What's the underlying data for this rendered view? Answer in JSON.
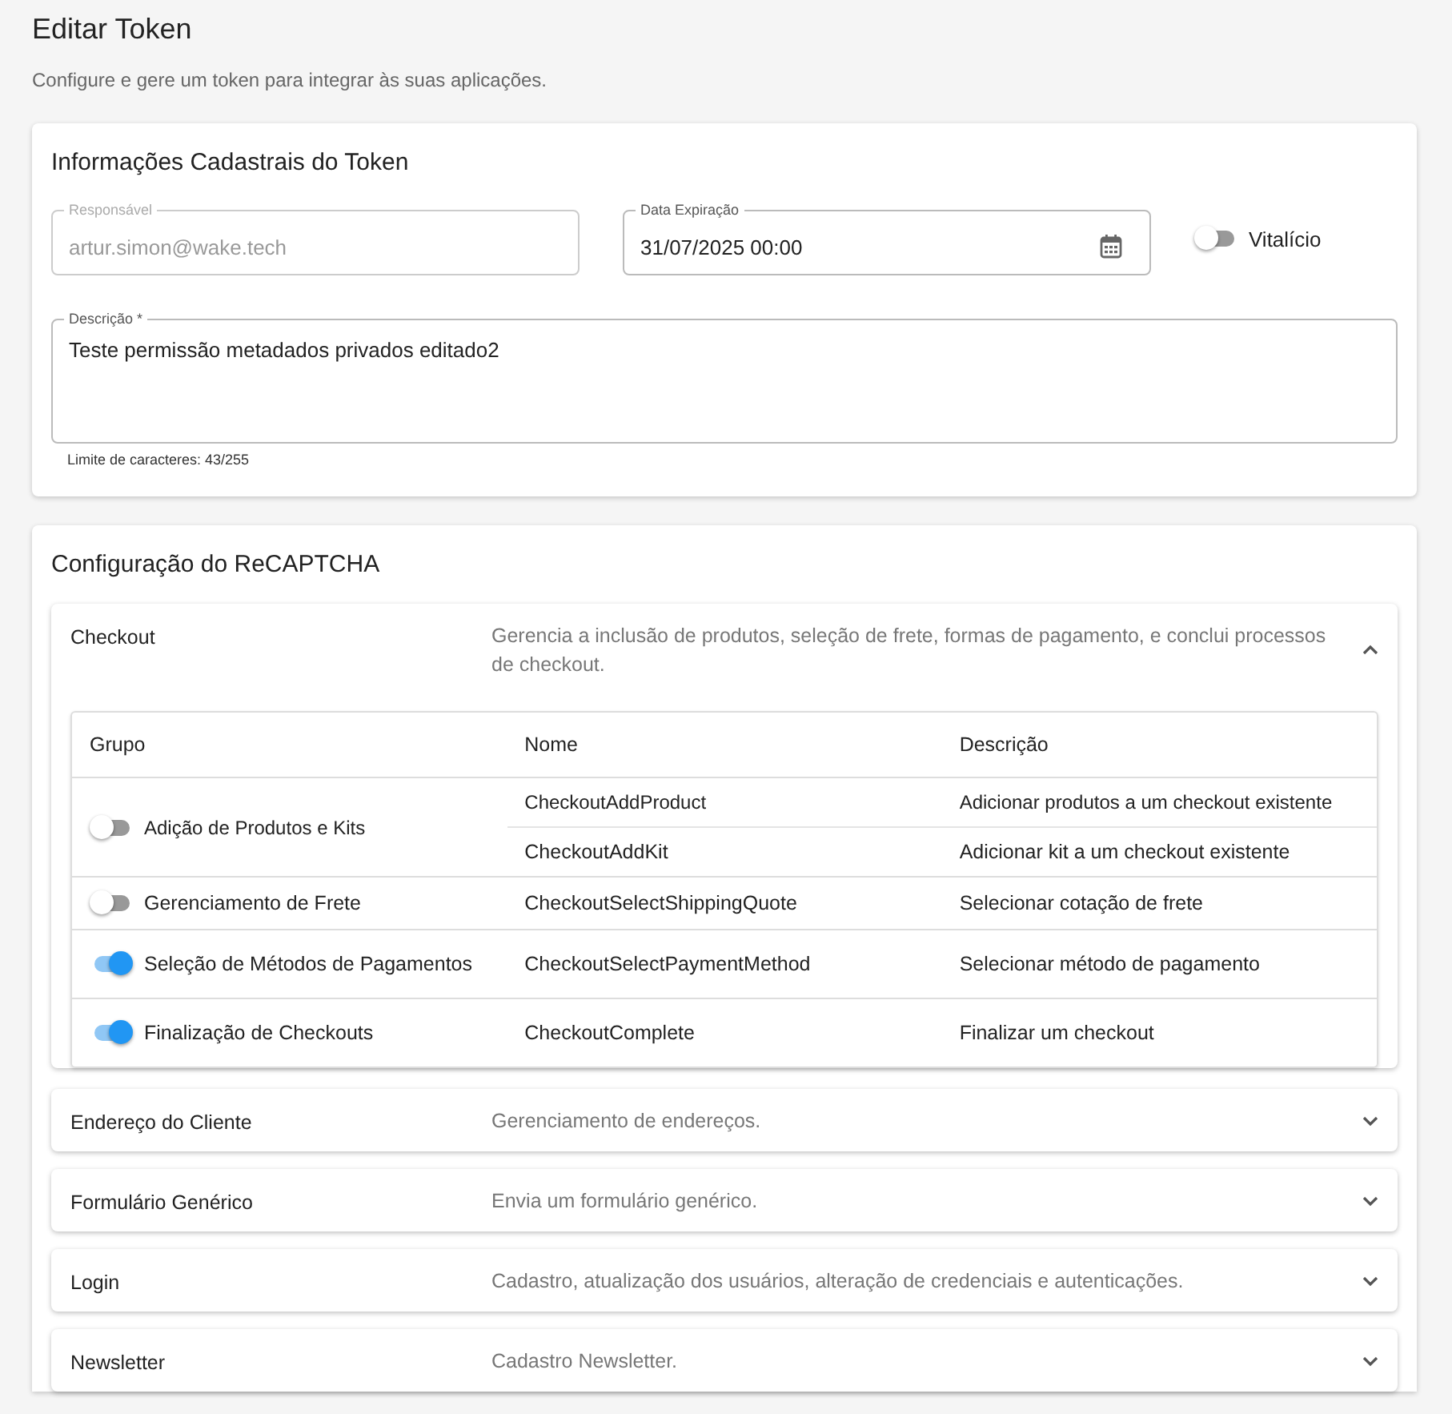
{
  "page": {
    "title": "Editar Token",
    "subtitle": "Configure e gere um token para integrar às suas aplicações."
  },
  "token_card": {
    "title": "Informações Cadastrais do Token",
    "responsible": {
      "label": "Responsável",
      "value": "artur.simon@wake.tech",
      "disabled": true
    },
    "expiry": {
      "label": "Data Expiração",
      "value": "31/07/2025 00:00"
    },
    "lifetime": {
      "label": "Vitalício",
      "on": false
    },
    "description": {
      "label": "Descrição *",
      "value": "Teste permissão metadados privados editado2",
      "helper": "Limite de caracteres: 43/255"
    }
  },
  "recaptcha": {
    "title": "Configuração do ReCAPTCHA",
    "columns": [
      "Grupo",
      "Nome",
      "Descrição"
    ],
    "sections": [
      {
        "title": "Checkout",
        "description": "Gerencia a inclusão de produtos, seleção de frete, formas de pagamento, e conclui processos de checkout.",
        "expanded": true,
        "groups": [
          {
            "label": "Adição de Produtos e Kits",
            "on": false,
            "operations": [
              {
                "name": "CheckoutAddProduct",
                "description": "Adicionar produtos a um checkout existente"
              },
              {
                "name": "CheckoutAddKit",
                "description": "Adicionar kit a um checkout existente"
              }
            ]
          },
          {
            "label": "Gerenciamento de Frete",
            "on": false,
            "operations": [
              {
                "name": "CheckoutSelectShippingQuote",
                "description": "Selecionar cotação de frete"
              }
            ]
          },
          {
            "label": "Seleção de Métodos de Pagamentos",
            "on": true,
            "operations": [
              {
                "name": "CheckoutSelectPaymentMethod",
                "description": "Selecionar método de pagamento"
              }
            ]
          },
          {
            "label": "Finalização de Checkouts",
            "on": true,
            "operations": [
              {
                "name": "CheckoutComplete",
                "description": "Finalizar um checkout"
              }
            ]
          }
        ]
      },
      {
        "title": "Endereço do Cliente",
        "description": "Gerenciamento de endereços.",
        "expanded": false
      },
      {
        "title": "Formulário Genérico",
        "description": "Envia um formulário genérico.",
        "expanded": false
      },
      {
        "title": "Login",
        "description": "Cadastro, atualização dos usuários, alteração de credenciais e autenticações.",
        "expanded": false
      },
      {
        "title": "Newsletter",
        "description": "Cadastro Newsletter.",
        "expanded": false
      }
    ]
  }
}
